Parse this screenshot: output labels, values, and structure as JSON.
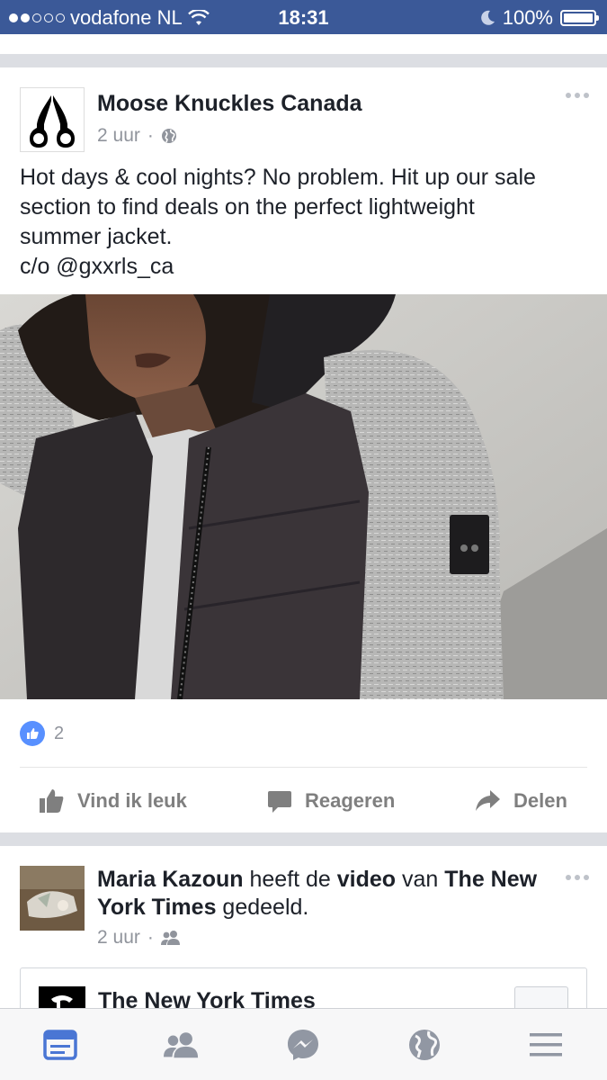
{
  "status_bar": {
    "carrier": "vodafone NL",
    "time": "18:31",
    "battery": "100%"
  },
  "post": {
    "author": "Moose Knuckles Canada",
    "time": "2 uur",
    "privacy_icon": "globe-icon",
    "text_lines": [
      "Hot days & cool nights? No problem. Hit up our sale",
      "section to find deals on the perfect lightweight",
      "summer jacket.",
      "c/o @gxxrls_ca"
    ],
    "like_count": "2",
    "actions": {
      "like": "Vind ik leuk",
      "comment": "Reageren",
      "share": "Delen"
    }
  },
  "shared_post": {
    "sharer": "Maria Kazoun",
    "middle_text": " heeft de ",
    "object": "video",
    "van_text": " van ",
    "source": "The New York Times",
    "suffix": " gedeeld.",
    "time": "2 uur",
    "privacy_icon": "friends-icon",
    "embed_page_name": "The New York Times"
  },
  "tab_bar": {
    "items": [
      "news-feed-icon",
      "friend-requests-icon",
      "messenger-icon",
      "notifications-globe-icon",
      "menu-icon"
    ],
    "active_color": "#4a76d4",
    "inactive_color": "#9197a3"
  },
  "colors": {
    "brand": "#3b5998",
    "like_blue": "#5890ff"
  }
}
